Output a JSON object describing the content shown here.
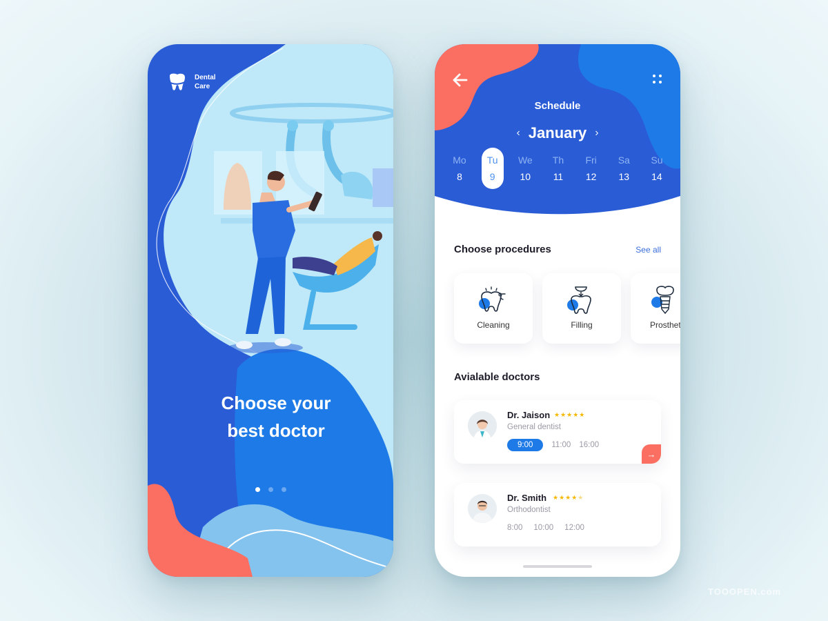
{
  "onboarding": {
    "brand_line1": "Dental",
    "brand_line2": "Care",
    "logo_icon": "tooth-icon",
    "headline_line1": "Choose your",
    "headline_line2": "best doctor",
    "pagination": {
      "pages": 3,
      "active": 1
    },
    "illustration": "dentist-with-tablet-and-patient-in-chair"
  },
  "schedule": {
    "back_icon": "arrow-left-icon",
    "menu_icon": "grid-dots-icon",
    "title": "Schedule",
    "month": "January",
    "prev_icon": "‹",
    "next_icon": "›",
    "days": [
      {
        "name": "Mo",
        "date": "8",
        "selected": false
      },
      {
        "name": "Tu",
        "date": "9",
        "selected": true
      },
      {
        "name": "We",
        "date": "10",
        "selected": false
      },
      {
        "name": "Th",
        "date": "11",
        "selected": false
      },
      {
        "name": "Fri",
        "date": "12",
        "selected": false
      },
      {
        "name": "Sa",
        "date": "13",
        "selected": false
      },
      {
        "name": "Su",
        "date": "14",
        "selected": false
      }
    ],
    "procedures_title": "Choose procedures",
    "see_all": "See all",
    "procedures": [
      {
        "label": "Cleaning",
        "icon": "tooth-sparkle-icon"
      },
      {
        "label": "Filling",
        "icon": "tooth-filling-icon"
      },
      {
        "label": "Prosthet",
        "icon": "tooth-implant-icon"
      }
    ],
    "doctors_title": "Avialable doctors",
    "doctors": [
      {
        "name": "Dr. Jaison",
        "rating": 5,
        "rating_max": 5,
        "specialty": "General dentist",
        "slots": [
          "9:00",
          "11:00",
          "16:00"
        ],
        "active_slot": "9:00",
        "action_icon": "arrow-right-icon"
      },
      {
        "name": "Dr. Smith",
        "rating": 4,
        "rating_max": 5,
        "specialty": "Orthodontist",
        "slots": [
          "8:00",
          "10:00",
          "12:00"
        ],
        "active_slot": null
      }
    ]
  },
  "colors": {
    "primary_blue": "#2a5cd6",
    "bright_blue": "#1e7ae6",
    "coral": "#fb6f62",
    "light_sky": "#bfe9f8",
    "star": "#f5b800"
  },
  "watermark": "TOOOPEN.com"
}
